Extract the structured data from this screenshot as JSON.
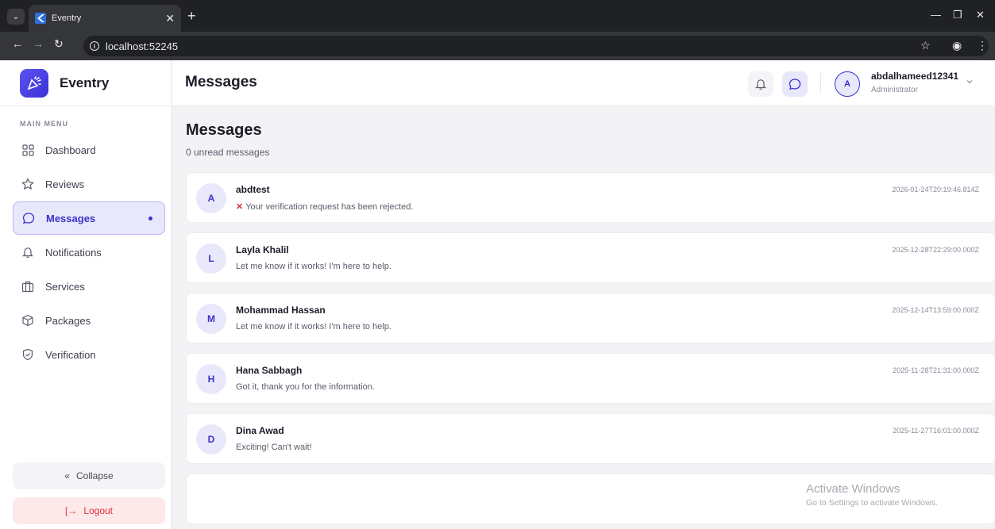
{
  "browser": {
    "tab_title": "Eventry",
    "url": "localhost:52245"
  },
  "sidebar": {
    "brand": "Eventry",
    "section_label": "MAIN MENU",
    "items": [
      {
        "label": "Dashboard",
        "icon": "grid-icon"
      },
      {
        "label": "Reviews",
        "icon": "star-icon"
      },
      {
        "label": "Messages",
        "icon": "chat-icon",
        "active": true
      },
      {
        "label": "Notifications",
        "icon": "bell-icon"
      },
      {
        "label": "Services",
        "icon": "briefcase-icon"
      },
      {
        "label": "Packages",
        "icon": "box-icon"
      },
      {
        "label": "Verification",
        "icon": "shield-check-icon"
      }
    ],
    "collapse_label": "Collapse",
    "logout_label": "Logout"
  },
  "topbar": {
    "title": "Messages",
    "user": {
      "initial": "A",
      "name": "abdalhameed12341",
      "role": "Administrator"
    }
  },
  "main": {
    "title": "Messages",
    "subtitle": "0 unread messages",
    "messages": [
      {
        "initial": "A",
        "name": "abdtest",
        "text": "Your verification request has been rejected.",
        "has_x": true,
        "time": "2026-01-24T20:19:46.814Z"
      },
      {
        "initial": "L",
        "name": "Layla Khalil",
        "text": "Let me know if it works! I'm here to help.",
        "time": "2025-12-28T22:29:00.000Z"
      },
      {
        "initial": "M",
        "name": "Mohammad Hassan",
        "text": "Let me know if it works! I'm here to help.",
        "time": "2025-12-14T13:59:00.000Z"
      },
      {
        "initial": "H",
        "name": "Hana Sabbagh",
        "text": "Got it, thank you for the information.",
        "time": "2025-11-28T21:31:00.000Z"
      },
      {
        "initial": "D",
        "name": "Dina Awad",
        "text": "Exciting! Can't wait!",
        "time": "2025-11-27T16:01:00.000Z"
      }
    ]
  },
  "watermark": {
    "title": "Activate Windows",
    "subtitle": "Go to Settings to activate Windows."
  },
  "colors": {
    "accent": "#3b31c9",
    "accent_light": "#e9e8fb",
    "danger": "#e0313c"
  }
}
